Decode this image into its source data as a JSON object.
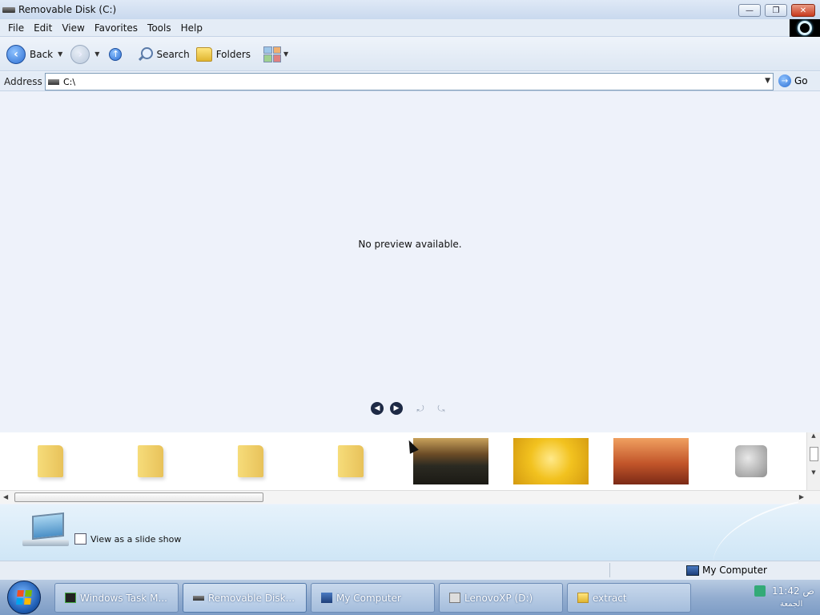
{
  "window": {
    "title": "Removable Disk (C:)"
  },
  "menu": {
    "items": [
      "File",
      "Edit",
      "View",
      "Favorites",
      "Tools",
      "Help"
    ]
  },
  "toolbar": {
    "back_label": "Back",
    "search_label": "Search",
    "folders_label": "Folders"
  },
  "address": {
    "label": "Address",
    "value": "C:\\",
    "go_label": "Go"
  },
  "preview": {
    "message": "No preview available."
  },
  "filmstrip": {
    "items": [
      {
        "type": "folder"
      },
      {
        "type": "folder"
      },
      {
        "type": "folder"
      },
      {
        "type": "folder"
      },
      {
        "type": "image",
        "icon": "tree-photo"
      },
      {
        "type": "image",
        "icon": "flower-photo"
      },
      {
        "type": "image",
        "icon": "desert-photo"
      },
      {
        "type": "image",
        "icon": "tools-icon"
      }
    ]
  },
  "taskpane": {
    "slideshow_label": "View as a slide show"
  },
  "statusbar": {
    "location": "My Computer"
  },
  "taskbar": {
    "tasks": [
      {
        "label": "Windows Task M...",
        "icon": "task-manager-icon"
      },
      {
        "label": "Removable Disk...",
        "icon": "removable-disk-icon"
      },
      {
        "label": "My Computer",
        "icon": "my-computer-icon"
      },
      {
        "label": "LenovoXP (D:)",
        "icon": "drive-icon"
      },
      {
        "label": "extract",
        "icon": "folder-icon"
      }
    ],
    "clock": "11:42 ص",
    "day": "الجمعة"
  },
  "colors": {
    "accent": "#2d6fd3",
    "close": "#c83a1e"
  }
}
